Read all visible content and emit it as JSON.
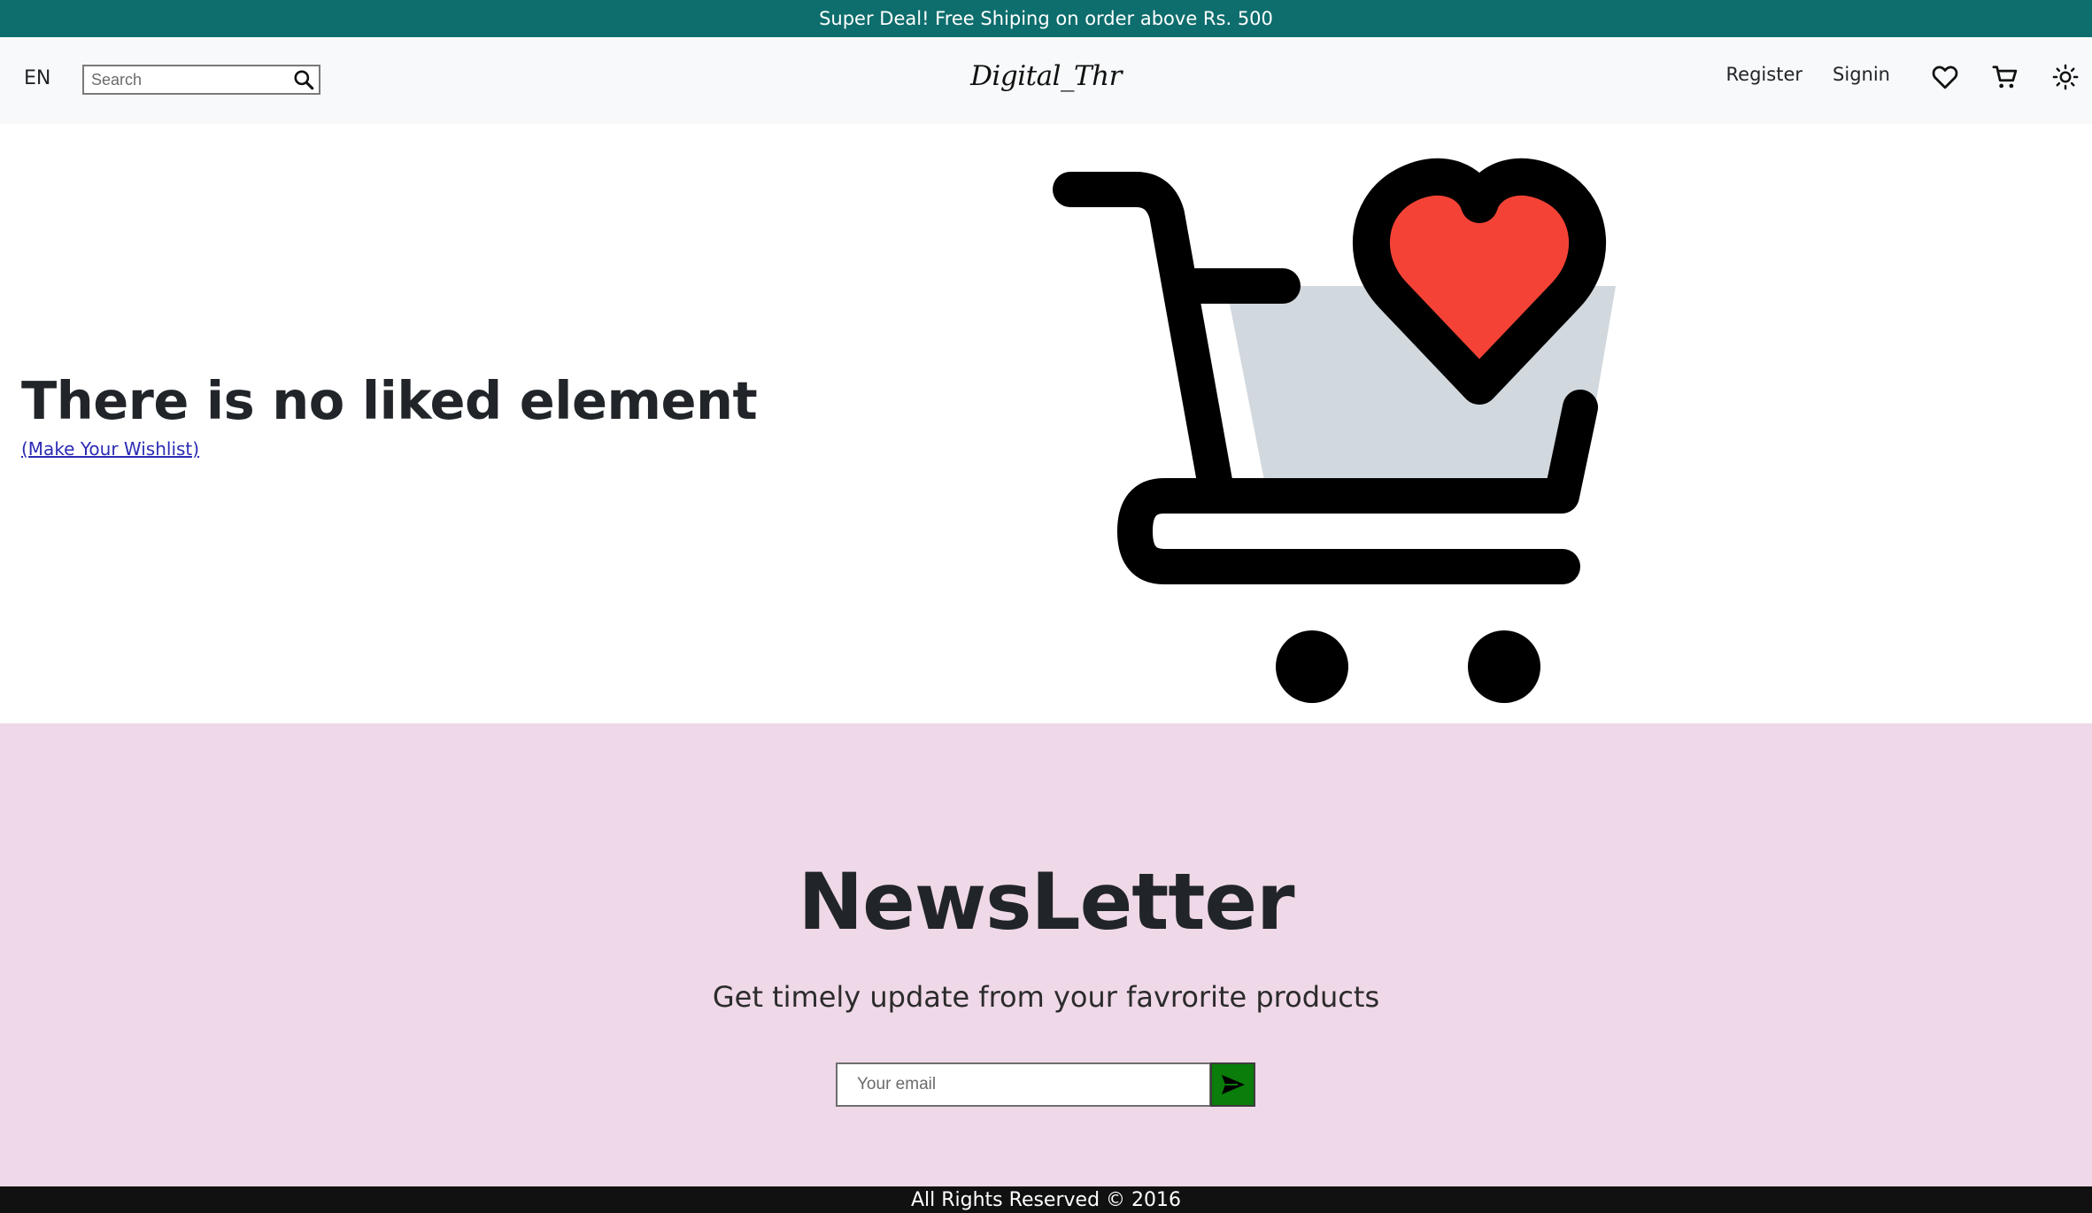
{
  "promo": {
    "text": "Super Deal! Free Shiping on order above Rs. 500"
  },
  "header": {
    "language": "EN",
    "search": {
      "placeholder": "Search",
      "value": "",
      "icon": "search-icon"
    },
    "logo": "Digital_Thr",
    "nav": {
      "register": "Register",
      "signin": "Signin",
      "wishlist_icon": "heart-icon",
      "cart_icon": "cart-icon",
      "theme_icon": "sun-icon"
    }
  },
  "wishlist": {
    "empty_message": "There is no liked element",
    "cta_link": "(Make Your Wishlist)",
    "illustration": "cart-with-heart-illustration"
  },
  "newsletter": {
    "title": "NewsLetter",
    "subtitle": "Get timely update from your favrorite products",
    "email_placeholder": "Your email",
    "email_value": "",
    "send_icon": "send-icon"
  },
  "footer": {
    "text": "All Rights Reserved © 2016"
  },
  "colors": {
    "promo_bg": "#0e6d6d",
    "header_bg": "#f8f9fa",
    "newsletter_bg": "#efd8e8",
    "send_button": "#0a7d0a",
    "footer_bg": "#111111",
    "heart": "#f44336",
    "cart_basket": "#d1d8de",
    "link": "#2b2bb5"
  }
}
